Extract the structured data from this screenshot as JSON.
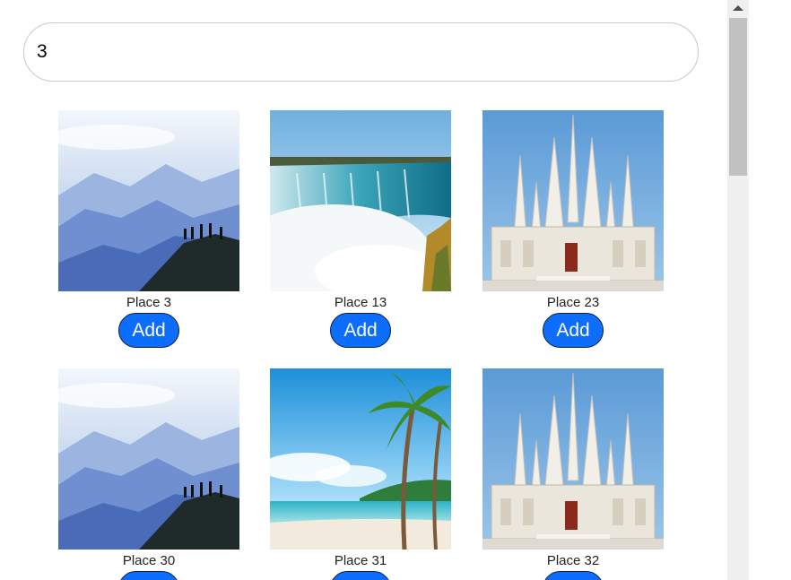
{
  "search": {
    "value": "3"
  },
  "cards": [
    {
      "caption": "Place 3",
      "add_label": "Add",
      "image": "mountain-hikers"
    },
    {
      "caption": "Place 13",
      "add_label": "Add",
      "image": "waterfall"
    },
    {
      "caption": "Place 23",
      "add_label": "Add",
      "image": "white-temple"
    },
    {
      "caption": "Place 30",
      "add_label": "Add",
      "image": "mountain-hikers"
    },
    {
      "caption": "Place 31",
      "add_label": "Add",
      "image": "palm-beach"
    },
    {
      "caption": "Place 32",
      "add_label": "Add",
      "image": "white-temple"
    }
  ],
  "colors": {
    "accent": "#0d6efd",
    "scroll_track": "#f0f0f0",
    "scroll_thumb": "#c1c1c1"
  }
}
